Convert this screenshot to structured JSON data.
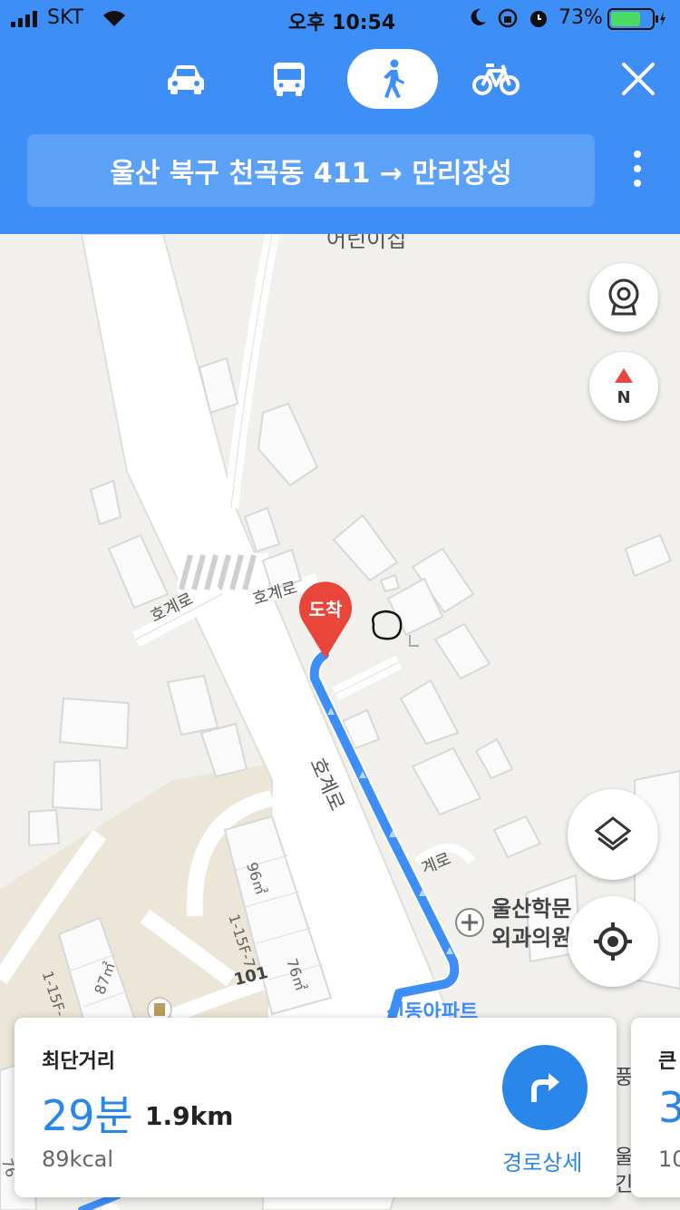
{
  "status_bar": {
    "carrier": "SKT",
    "time": "오후 10:54",
    "battery": "73%",
    "battery_level": 0.73
  },
  "header": {
    "modes": [
      {
        "name": "car",
        "active": false
      },
      {
        "name": "bus",
        "active": false
      },
      {
        "name": "walk",
        "active": true
      },
      {
        "name": "bike",
        "active": false
      }
    ],
    "route": "울산 북구 천곡동 411 → 만리장성"
  },
  "map": {
    "marker_label": "도착",
    "labels": {
      "top_place": "어린이집",
      "road_left": "호계로",
      "road_center": "호계로",
      "road_main": "호계로",
      "road_right": "계로",
      "clinic_line1": "울산학문",
      "clinic_line2": "외과의원",
      "area_96": "96㎡",
      "area_76": "76㎡",
      "area_87": "87㎡",
      "lot_1": "1-15F-7",
      "lot_2": "1-15F-",
      "road_101": "101",
      "apt": "신동아파트",
      "right_fragment_1": "풍",
      "right_fragment_2": "울",
      "right_fragment_3": "긴",
      "left_fragment": "76"
    }
  },
  "colors": {
    "header": "#3d8ff7",
    "route": "#3d8ff7",
    "marker": "#e9453b",
    "accent": "#2a86e8"
  },
  "card": {
    "title": "최단거리",
    "time": "29분",
    "distance": "1.9km",
    "kcal": "89kcal",
    "detail": "경로상세"
  },
  "card2": {
    "title": "큰",
    "time": "3",
    "sub": "10"
  }
}
